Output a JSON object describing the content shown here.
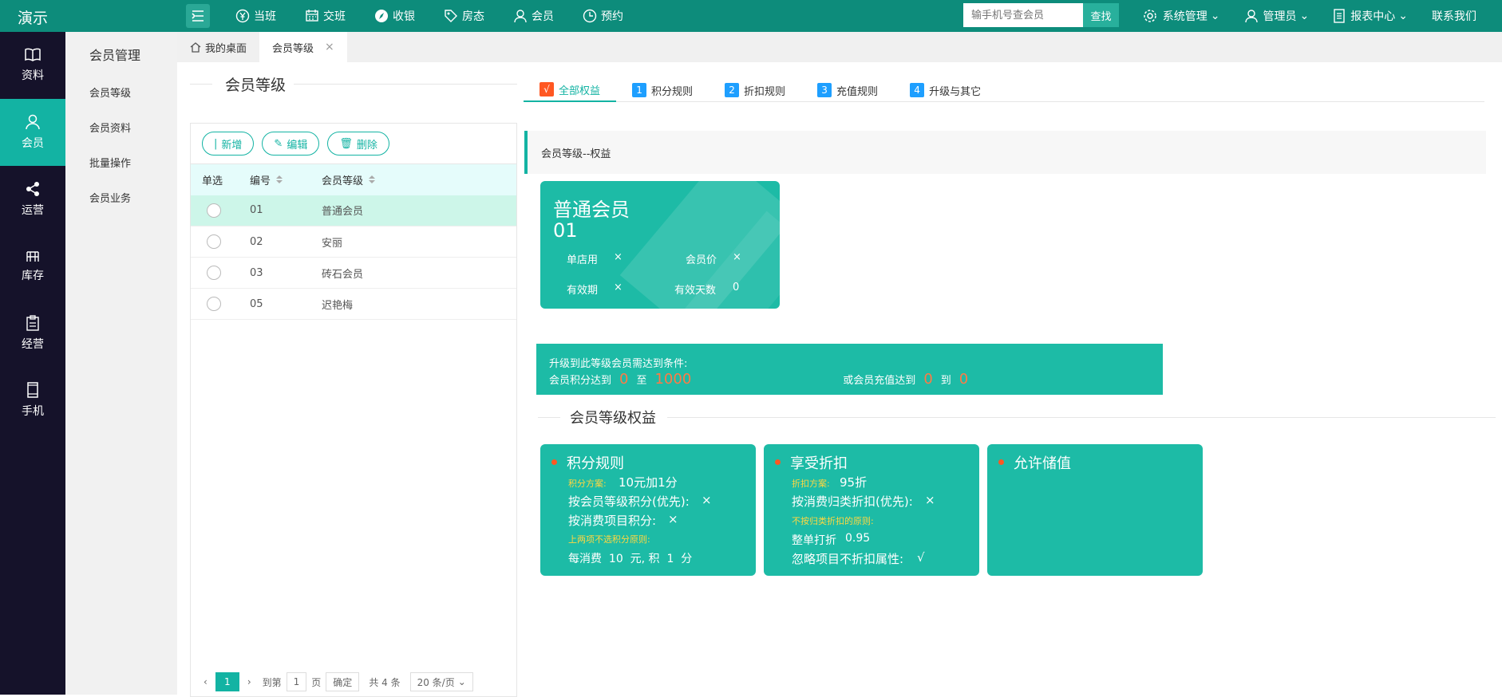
{
  "topbar": {
    "brand": "演示",
    "nav": [
      "当班",
      "交班",
      "收银",
      "房态",
      "会员",
      "预约"
    ],
    "search_placeholder": "输手机号查会员",
    "search_btn": "查找",
    "right": [
      "系统管理",
      "管理员",
      "报表中心",
      "联系我们"
    ]
  },
  "leftnav": [
    "资料",
    "会员",
    "运营",
    "库存",
    "经营",
    "手机"
  ],
  "sidebar": {
    "title": "会员管理",
    "items": [
      "会员等级",
      "会员资料",
      "批量操作",
      "会员业务"
    ]
  },
  "tabs": {
    "home": "我的桌面",
    "current": "会员等级"
  },
  "left": {
    "title": "会员等级",
    "buttons": [
      "新增",
      "编辑",
      "删除"
    ],
    "headers": [
      "单选",
      "编号",
      "会员等级"
    ],
    "rows": [
      {
        "no": "01",
        "name": "普通会员"
      },
      {
        "no": "02",
        "name": "安丽"
      },
      {
        "no": "03",
        "name": "砖石会员"
      },
      {
        "no": "05",
        "name": "迟艳梅"
      }
    ],
    "pager": {
      "page": "1",
      "goto": "到第",
      "unit": "页",
      "confirm": "确定",
      "total": "共 4 条",
      "per": "20 条/页"
    }
  },
  "right": {
    "tabs": [
      {
        "n": "√",
        "label": "全部权益"
      },
      {
        "n": "1",
        "label": "积分规则"
      },
      {
        "n": "2",
        "label": "折扣规则"
      },
      {
        "n": "3",
        "label": "充值规则"
      },
      {
        "n": "4",
        "label": "升级与其它"
      }
    ],
    "quote": "会员等级--权益",
    "card": {
      "name": "普通会员",
      "no": "01",
      "single_store_label": "单店用",
      "single_store": "×",
      "member_price_label": "会员价",
      "member_price": "×",
      "validity_label": "有效期",
      "validity": "×",
      "valid_days_label": "有效天数",
      "valid_days": "0"
    },
    "cond": {
      "title": "升级到此等级会员需达到条件:",
      "points_label": "会员积分达到",
      "points_from": "0",
      "to1": "至",
      "points_to": "1000",
      "recharge_label": "或会员充值达到",
      "recharge_from": "0",
      "to2": "到",
      "recharge_to": "0"
    },
    "benefits_title": "会员等级权益",
    "points": {
      "title": "积分规则",
      "scheme_label": "积分方案:",
      "scheme": "10元加1分",
      "l1": "按会员等级积分(优先):",
      "v1": "×",
      "l2": "按消费项目积分:",
      "v2": "×",
      "note": "上两项不选积分原则:",
      "l3": "每消费",
      "spend": "10",
      "l4": "元, 积",
      "pts": "1",
      "l5": "分"
    },
    "discount": {
      "title": "享受折扣",
      "scheme_label": "折扣方案:",
      "scheme": "95折",
      "l1": "按消费归类折扣(优先):",
      "v1": "×",
      "note": "不按归类折扣的原则:",
      "l2": "整单打折",
      "v2": "0.95",
      "l3": "忽略项目不折扣属性:",
      "v3": "√"
    },
    "stored": {
      "title": "允许储值"
    }
  }
}
